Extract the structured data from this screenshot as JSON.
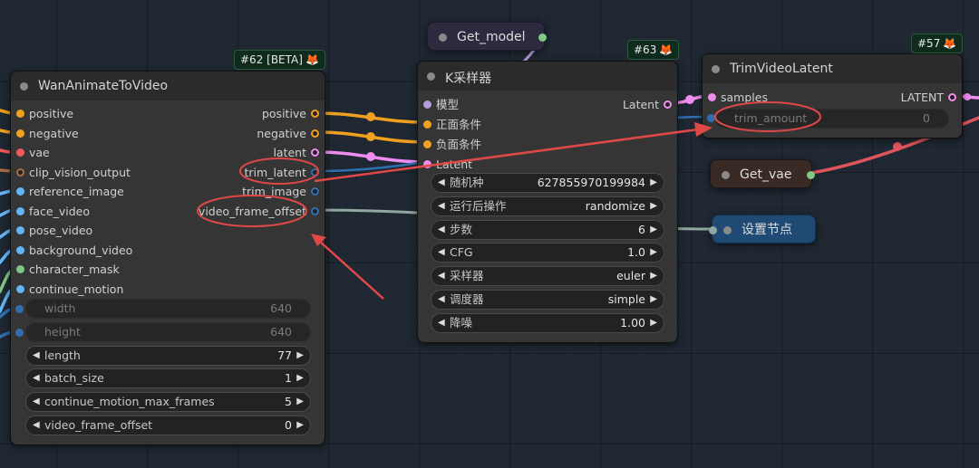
{
  "colors": {
    "canvas": "#1f2833",
    "node_body": "#353535",
    "node_title": "#2b2b2b",
    "badge_bg": "#0e2b1e",
    "conditioning": "#f0a020",
    "latent": "#f08cf0",
    "vae": "#f05a5a",
    "clip_vision_output": "#a86d4a",
    "image": "#64b5f6",
    "mask": "#81c784",
    "model": "#b39ddb",
    "int": "#2f6fb0",
    "annotation": "#e04848"
  },
  "node_wan": {
    "title": "WanAnimateToVideo",
    "badge": "#62 [BETA]",
    "inputs": [
      {
        "label": "positive",
        "color": "#f0a020"
      },
      {
        "label": "negative",
        "color": "#f0a020"
      },
      {
        "label": "vae",
        "color": "#f05a5a"
      },
      {
        "label": "clip_vision_output",
        "color": "#a86d4a"
      },
      {
        "label": "reference_image",
        "color": "#64b5f6"
      },
      {
        "label": "face_video",
        "color": "#64b5f6"
      },
      {
        "label": "pose_video",
        "color": "#64b5f6"
      },
      {
        "label": "background_video",
        "color": "#64b5f6"
      },
      {
        "label": "character_mask",
        "color": "#81c784"
      },
      {
        "label": "continue_motion",
        "color": "#64b5f6"
      }
    ],
    "outputs": [
      {
        "label": "positive"
      },
      {
        "label": "negative"
      },
      {
        "label": "latent"
      },
      {
        "label": "trim_latent"
      },
      {
        "label": "trim_image"
      },
      {
        "label": "video_frame_offset"
      }
    ],
    "widgets": [
      {
        "label": "width",
        "value": "640",
        "disabled": true
      },
      {
        "label": "height",
        "value": "640",
        "disabled": true
      },
      {
        "label": "length",
        "value": "77",
        "disabled": false
      },
      {
        "label": "batch_size",
        "value": "1",
        "disabled": false
      },
      {
        "label": "continue_motion_max_frames",
        "value": "5",
        "disabled": false
      },
      {
        "label": "video_frame_offset",
        "value": "0",
        "disabled": false
      }
    ]
  },
  "node_ksampler": {
    "title": "K采样器",
    "badge": "#63",
    "inputs": [
      {
        "label": "模型",
        "color": "#b39ddb"
      },
      {
        "label": "正面条件",
        "color": "#f0a020"
      },
      {
        "label": "负面条件",
        "color": "#f0a020"
      },
      {
        "label": "Latent",
        "color": "#f08cf0"
      }
    ],
    "output": "Latent",
    "widgets": [
      {
        "label": "随机种",
        "value": "627855970199984"
      },
      {
        "label": "运行后操作",
        "value": "randomize"
      },
      {
        "label": "步数",
        "value": "6"
      },
      {
        "label": "CFG",
        "value": "1.0"
      },
      {
        "label": "采样器",
        "value": "euler"
      },
      {
        "label": "调度器",
        "value": "simple"
      },
      {
        "label": "降噪",
        "value": "1.00"
      }
    ]
  },
  "node_trim": {
    "title": "TrimVideoLatent",
    "badge": "#57",
    "input": "samples",
    "output": "LATENT",
    "widget": {
      "label": "trim_amount",
      "value": "0"
    }
  },
  "get_model": {
    "title": "Get_model"
  },
  "get_vae": {
    "title": "Get_vae"
  },
  "set_node": {
    "title": "设置节点"
  }
}
